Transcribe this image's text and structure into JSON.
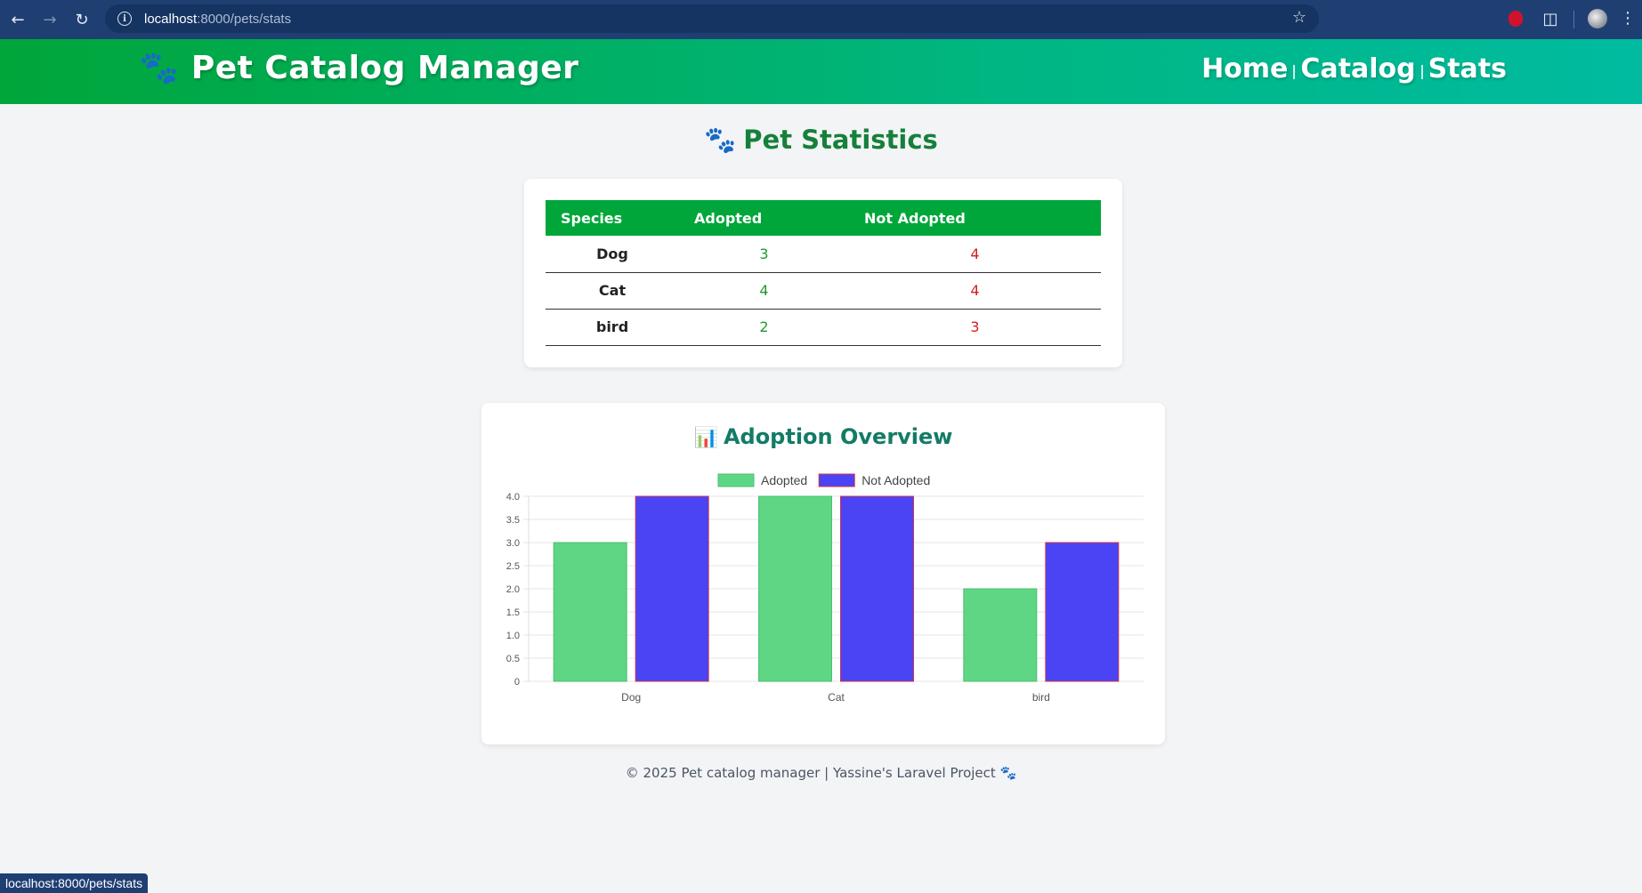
{
  "browser": {
    "url_host": "localhost",
    "url_path": ":8000/pets/stats",
    "status_url": "localhost:8000/pets/stats"
  },
  "header": {
    "brand": "Pet Catalog Manager",
    "nav": [
      "Home",
      "Catalog",
      "Stats"
    ]
  },
  "page": {
    "title": "Pet Statistics"
  },
  "stats_table": {
    "headers": [
      "Species",
      "Adopted",
      "Not Adopted"
    ],
    "rows": [
      {
        "species": "Dog",
        "adopted": "3",
        "not_adopted": "4"
      },
      {
        "species": "Cat",
        "adopted": "4",
        "not_adopted": "4"
      },
      {
        "species": "bird",
        "adopted": "2",
        "not_adopted": "3"
      }
    ]
  },
  "chart_section": {
    "title": "Adoption Overview"
  },
  "chart_data": {
    "type": "bar",
    "categories": [
      "Dog",
      "Cat",
      "bird"
    ],
    "series": [
      {
        "name": "Adopted",
        "values": [
          3,
          4,
          2
        ],
        "color": "#5fd684"
      },
      {
        "name": "Not Adopted",
        "values": [
          4,
          4,
          3
        ],
        "color": "#4a44f5"
      }
    ],
    "ylim": [
      0,
      4
    ],
    "yticks": [
      "0",
      "0.5",
      "1.0",
      "1.5",
      "2.0",
      "2.5",
      "3.0",
      "3.5",
      "4.0"
    ],
    "legend": "top-center",
    "grid": true
  },
  "footer": {
    "text": "© 2025 Pet catalog manager | Yassine's Laravel Project"
  },
  "colors": {
    "header_start": "#00a63a",
    "header_end": "#00bba0",
    "title_green": "#16803a",
    "adopted_text": "#1d9b30",
    "not_adopted_text": "#d51f1f"
  }
}
